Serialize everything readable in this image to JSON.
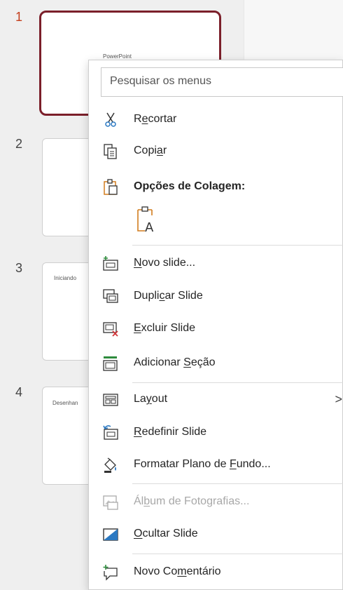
{
  "slides": [
    {
      "number": "1",
      "thumb_text": "PowerPoint",
      "selected": true
    },
    {
      "number": "2",
      "thumb_text": ""
    },
    {
      "number": "3",
      "thumb_text": "Iniciando"
    },
    {
      "number": "4",
      "thumb_text": "Desenhan"
    }
  ],
  "menu": {
    "search_placeholder": "Pesquisar os menus",
    "items": [
      {
        "id": "cut",
        "pre": "R",
        "u": "e",
        "post": "cortar"
      },
      {
        "id": "copy",
        "pre": "Copi",
        "u": "a",
        "post": "r"
      },
      {
        "id": "paste-options",
        "pre": "Opções de Colagem:",
        "u": "",
        "post": ""
      },
      {
        "id": "new-slide",
        "pre": "",
        "u": "N",
        "post": "ovo slide..."
      },
      {
        "id": "duplicate-slide",
        "pre": "Dupli",
        "u": "c",
        "post": "ar Slide"
      },
      {
        "id": "delete-slide",
        "pre": "",
        "u": "E",
        "post": "xcluir Slide"
      },
      {
        "id": "add-section",
        "pre": "Adicionar ",
        "u": "S",
        "post": "eção"
      },
      {
        "id": "layout",
        "pre": "La",
        "u": "y",
        "post": "out"
      },
      {
        "id": "reset-slide",
        "pre": "",
        "u": "R",
        "post": "edefinir Slide"
      },
      {
        "id": "format-background",
        "pre": "Formatar Plano de ",
        "u": "F",
        "post": "undo..."
      },
      {
        "id": "photo-album",
        "pre": "Ál",
        "u": "b",
        "post": "um de Fotografias..."
      },
      {
        "id": "hide-slide",
        "pre": "",
        "u": "O",
        "post": "cultar Slide"
      },
      {
        "id": "new-comment",
        "pre": "Novo Co",
        "u": "m",
        "post": "entário"
      }
    ],
    "layout_chevron": ">"
  },
  "colors": {
    "accent": "#c43e1c",
    "selected_border": "#7b1f2a",
    "icon_orange": "#d27d1e",
    "icon_green": "#2e8b3d",
    "icon_red": "#d13438"
  }
}
